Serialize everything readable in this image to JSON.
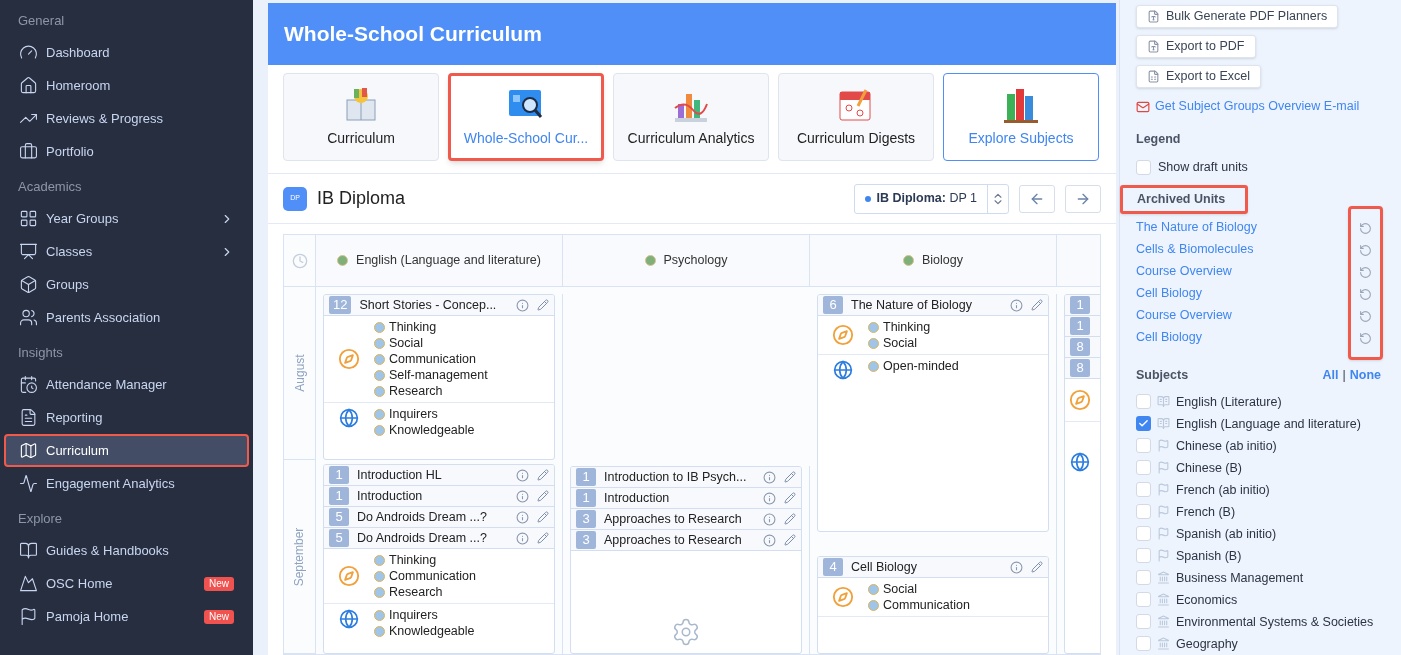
{
  "sidebar": {
    "sections": [
      {
        "heading": "General",
        "items": [
          {
            "label": "Dashboard",
            "selected": false,
            "highlighted": false
          },
          {
            "label": "Homeroom",
            "selected": false,
            "highlighted": false
          },
          {
            "label": "Reviews & Progress",
            "selected": false,
            "highlighted": false
          },
          {
            "label": "Portfolio",
            "selected": false,
            "highlighted": false
          }
        ]
      },
      {
        "heading": "Academics",
        "items": [
          {
            "label": "Year Groups",
            "selected": false,
            "highlighted": false,
            "has_submenu": true
          },
          {
            "label": "Classes",
            "selected": false,
            "highlighted": false,
            "has_submenu": true
          },
          {
            "label": "Groups",
            "selected": false,
            "highlighted": false,
            "has_submenu": false
          },
          {
            "label": "Parents Association",
            "selected": false,
            "highlighted": false
          }
        ]
      },
      {
        "heading": "Insights",
        "items": [
          {
            "label": "Attendance Manager",
            "selected": false,
            "highlighted": false
          },
          {
            "label": "Reporting",
            "selected": false,
            "highlighted": false
          },
          {
            "label": "Curriculum",
            "selected": true,
            "highlighted": true
          },
          {
            "label": "Engagement Analytics",
            "selected": false,
            "highlighted": false
          }
        ]
      },
      {
        "heading": "Explore",
        "items": [
          {
            "label": "Guides & Handbooks",
            "selected": false,
            "highlighted": false
          },
          {
            "label": "OSC Home",
            "selected": false,
            "highlighted": false,
            "badge": "New"
          },
          {
            "label": "Pamoja Home",
            "selected": false,
            "highlighted": false,
            "badge": "New"
          }
        ]
      }
    ]
  },
  "page_title": "Whole-School Curriculum",
  "apps": [
    {
      "label": "Curriculum",
      "selected": false,
      "highlighted": false
    },
    {
      "label": "Whole-School Cur...",
      "selected": true,
      "highlighted": true
    },
    {
      "label": "Curriculum Analytics",
      "selected": false,
      "highlighted": false
    },
    {
      "label": "Curriculum Digests",
      "selected": false,
      "highlighted": false
    },
    {
      "label": "Explore Subjects",
      "selected": true,
      "highlighted": false
    }
  ],
  "program": {
    "logo_text": "DP",
    "title": "IB Diploma",
    "selector": "**IB Diploma:** DP 1"
  },
  "grid": {
    "columns": [
      {
        "name": "English (Language and literature)"
      },
      {
        "name": "Psychology"
      },
      {
        "name": "Biology"
      }
    ],
    "months": [
      "August",
      "September"
    ],
    "lanes": [
      {
        "cards": [
          {
            "units": [
              {
                "number": "12",
                "title": "Short Stories - Concep..."
              }
            ],
            "atl": [
              "Thinking",
              "Social",
              "Communication",
              "Self-management",
              "Research"
            ],
            "profile": [
              "Inquirers",
              "Knowledgeable"
            ]
          },
          {
            "units": [
              {
                "number": "1",
                "title": "Introduction HL"
              },
              {
                "number": "1",
                "title": "Introduction"
              },
              {
                "number": "5",
                "title": "Do Androids Dream ...?"
              },
              {
                "number": "5",
                "title": "Do Androids Dream ...?"
              }
            ],
            "atl": [
              "Thinking",
              "Communication",
              "Research"
            ],
            "profile": [
              "Inquirers",
              "Knowledgeable"
            ]
          }
        ]
      },
      {
        "cards": [
          {
            "units": [
              {
                "number": "1",
                "title": "Introduction to IB Psych..."
              },
              {
                "number": "1",
                "title": "Introduction"
              },
              {
                "number": "3",
                "title": "Approaches to Research"
              },
              {
                "number": "3",
                "title": "Approaches to Research"
              }
            ]
          }
        ]
      },
      {
        "cards": [
          {
            "units": [
              {
                "number": "6",
                "title": "The Nature of Biology"
              }
            ],
            "atl": [
              "Thinking",
              "Social"
            ],
            "profile": [
              "Open-minded"
            ]
          },
          {
            "units": [
              {
                "number": "4",
                "title": "Cell Biology"
              }
            ],
            "atl": [
              "Social",
              "Communication"
            ]
          }
        ]
      },
      {
        "cards": [
          {
            "kind": "clipped",
            "units": [
              {
                "number": "1"
              },
              {
                "number": "1"
              },
              {
                "number": "8"
              },
              {
                "number": "8"
              }
            ]
          }
        ]
      }
    ]
  },
  "side": {
    "buttons": [
      "Bulk Generate PDF Planners",
      "Export to PDF",
      "Export to Excel"
    ],
    "email_link": "Get Subject Groups Overview E-mail",
    "legend": {
      "heading": "Legend",
      "draft": {
        "label": "Show draft units",
        "checked": false
      }
    },
    "archived": {
      "heading": "Archived Units",
      "highlighted": true,
      "icons_highlighted": true,
      "units": [
        "The Nature of Biology",
        "Cells & Biomolecules",
        "Course Overview",
        "Cell Biology",
        "Course Overview",
        "Cell Biology"
      ]
    },
    "subjects": {
      "heading": "Subjects",
      "all": "All",
      "separator": "|",
      "none": "None",
      "items": [
        {
          "label": "English (Literature)",
          "checked": false,
          "kind": "book"
        },
        {
          "label": "English (Language and literature)",
          "checked": true,
          "kind": "book"
        },
        {
          "label": "Chinese (ab initio)",
          "checked": false,
          "kind": "flag"
        },
        {
          "label": "Chinese (B)",
          "checked": false,
          "kind": "flag"
        },
        {
          "label": "French (ab initio)",
          "checked": false,
          "kind": "flag"
        },
        {
          "label": "French (B)",
          "checked": false,
          "kind": "flag"
        },
        {
          "label": "Spanish (ab initio)",
          "checked": false,
          "kind": "flag"
        },
        {
          "label": "Spanish (B)",
          "checked": false,
          "kind": "flag"
        },
        {
          "label": "Business Management",
          "checked": false,
          "kind": "building"
        },
        {
          "label": "Economics",
          "checked": false,
          "kind": "building"
        },
        {
          "label": "Environmental Systems & Societies",
          "checked": false,
          "kind": "building"
        },
        {
          "label": "Geography",
          "checked": false,
          "kind": "building"
        }
      ]
    }
  }
}
